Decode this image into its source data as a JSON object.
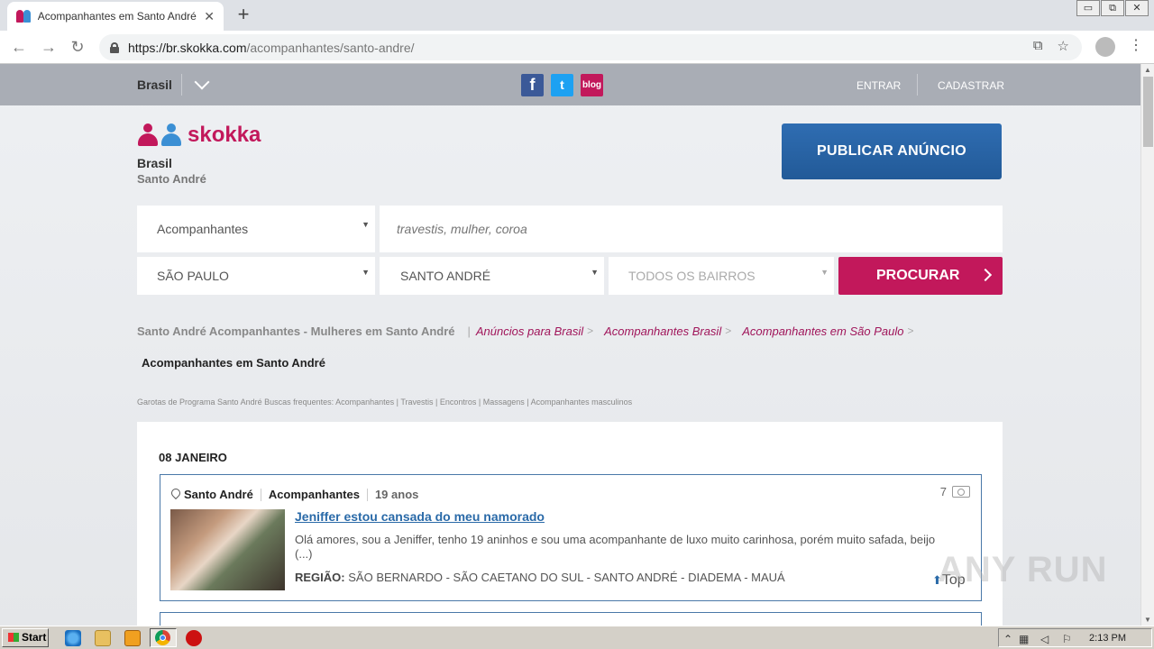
{
  "browser": {
    "tab_title": "Acompanhantes em Santo André e g",
    "tab_close": "✕",
    "new_tab": "+",
    "url_host": "https://br.skokka.com",
    "url_path": "/acompanhantes/santo-andre/",
    "back": "←",
    "forward": "→",
    "reload": "↻",
    "translate_icon": "⧉",
    "star_icon": "☆",
    "menu_icon": "⋮",
    "win_min": "▭",
    "win_max": "⧉",
    "win_close": "✕"
  },
  "topbar": {
    "country": "Brasil",
    "facebook": "f",
    "twitter": "t",
    "blog": "blog",
    "login": "ENTRAR",
    "register": "CADASTRAR"
  },
  "header": {
    "logo_text": "skokka",
    "location_country": "Brasil",
    "location_city": "Santo André",
    "publish_button": "PUBLICAR ANÚNCIO"
  },
  "search": {
    "category": "Acompanhantes",
    "keyword_placeholder": "travestis, mulher, coroa",
    "state": "SÃO PAULO",
    "city": "SANTO ANDRÉ",
    "district": "TODOS OS BAIRROS",
    "submit": "PROCURAR"
  },
  "breadcrumb": {
    "main": "Santo André Acompanhantes - Mulheres em Santo André",
    "links": [
      "Anúncios para Brasil",
      "Acompanhantes Brasil",
      "Acompanhantes em São Paulo"
    ],
    "current": "Acompanhantes em Santo André"
  },
  "frequent_searches": "Garotas de Programa Santo André  Buscas frequentes: Acompanhantes | Travestis | Encontros | Massagens | Acompanhantes masculinos",
  "listings": {
    "date_heading": "08 JANEIRO",
    "items": [
      {
        "city": "Santo André",
        "category": "Acompanhantes",
        "age": "19 anos",
        "photo_count": "7",
        "title": "Jeniffer estou cansada do meu namorado",
        "description": "Olá amores, sou a Jeniffer, tenho 19 aninhos e sou uma acompanhante de luxo muito carinhosa, porém muito safada, beijo (...)",
        "region_label": "REGIÃO:",
        "region": "SÃO BERNARDO - SÃO CAETANO DO SUL - SANTO ANDRÉ - DIADEMA - MAUÁ",
        "top_label": "Top",
        "top_arrow": "⬆"
      }
    ]
  },
  "watermark": "ANY RUN",
  "taskbar": {
    "start": "Start",
    "clock": "2:13 PM"
  },
  "colors": {
    "brand_pink": "#c2185b",
    "brand_blue": "#2f6db2",
    "logo_blue": "#3b8fd4"
  }
}
